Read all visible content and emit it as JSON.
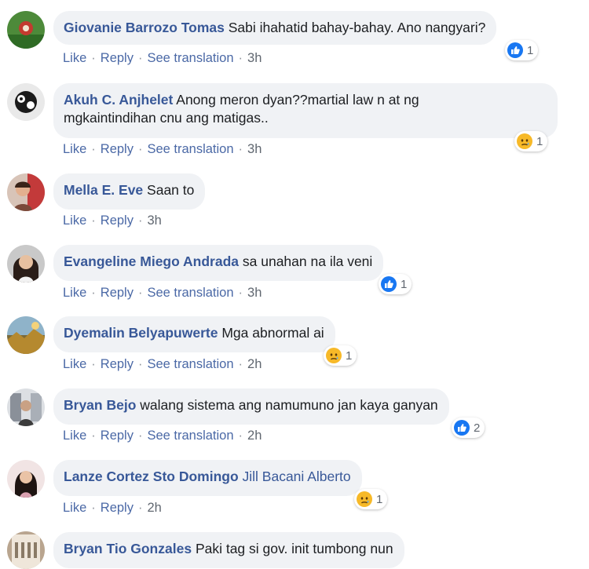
{
  "action_labels": {
    "like": "Like",
    "reply": "Reply",
    "see_translation": "See translation"
  },
  "colors": {
    "author": "#385898",
    "bubble": "#f0f2f5",
    "like_blue": "#1877f2",
    "sad_yellow": "#f7b928"
  },
  "comments": [
    {
      "author": "Giovanie Barrozo Tomas",
      "text": "Sabi ihahatid bahay-bahay. Ano nangyari?",
      "time": "3h",
      "reaction_icon": "like-icon",
      "reaction_count": "1"
    },
    {
      "author": "Akuh C. Anjhelet",
      "text": "Anong meron dyan??martial law n at ng",
      "text_line2": "mgkaintindihan cnu ang matigas..",
      "time": "3h",
      "reaction_icon": "sad-icon",
      "reaction_count": "1"
    },
    {
      "author": "Mella E. Eve",
      "text": "Saan to",
      "time": "3h"
    },
    {
      "author": "Evangeline Miego Andrada",
      "text": "sa unahan na ila veni",
      "time": "3h",
      "reaction_icon": "like-icon",
      "reaction_count": "1"
    },
    {
      "author": "Dyemalin Belyapuwerte",
      "text": "Mga abnormal ai",
      "time": "2h",
      "reaction_icon": "sad-icon",
      "reaction_count": "1"
    },
    {
      "author": "Bryan Bejo",
      "text": "walang sistema ang namumuno jan kaya ganyan",
      "time": "2h",
      "reaction_icon": "like-icon",
      "reaction_count": "2"
    },
    {
      "author": "Lanze Cortez Sto Domingo",
      "text": "Jill Bacani Alberto",
      "time": "2h",
      "reaction_icon": "sad-icon",
      "reaction_count": "1"
    },
    {
      "author": "Bryan Tio Gonzales",
      "text": "Paki tag si gov. init tumbong nun"
    }
  ]
}
